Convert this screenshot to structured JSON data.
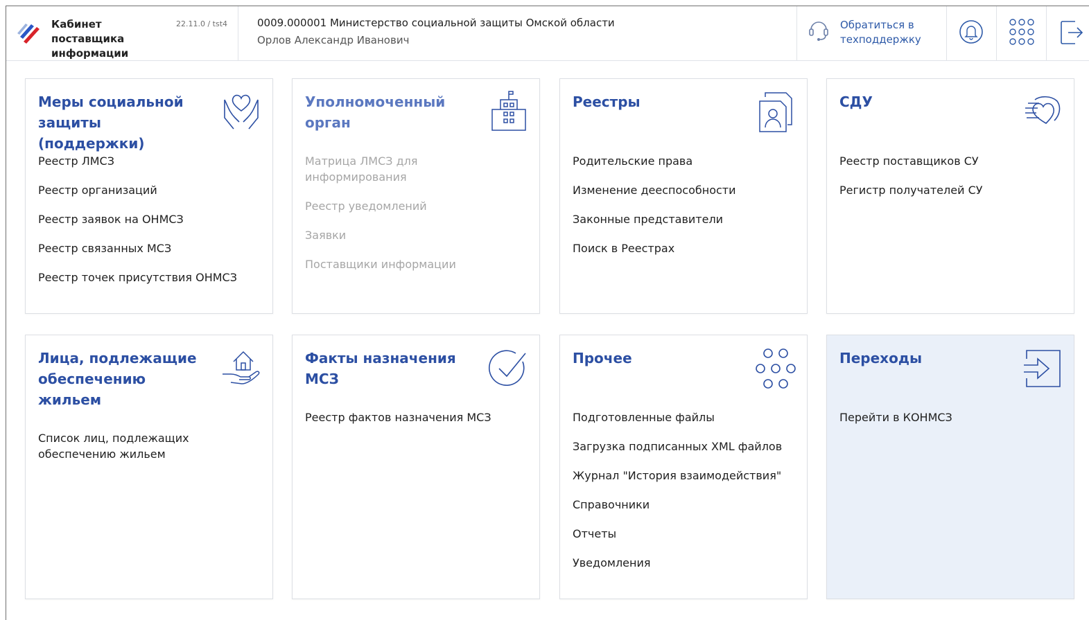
{
  "header": {
    "brand_title": "Кабинет поставщика информации",
    "version": "22.11.0 / tst4",
    "org_name": "0009.000001 Министерство социальной защиты Омской области",
    "user_name": "Орлов Александр Иванович",
    "support_label": "Обратиться в техподдержку",
    "colors": {
      "accent": "#2c4fa3",
      "brand_red": "#d8232a",
      "brand_blue": "#2a56c6"
    }
  },
  "cards": [
    {
      "title": "Меры социальной защиты (поддержки)",
      "icon": "hands-heart-icon",
      "items": [
        "Реестр ЛМСЗ",
        "Реестр организаций",
        "Реестр заявок на ОНМСЗ",
        "Реестр связанных МСЗ",
        "Реестр точек присутствия ОНМСЗ"
      ]
    },
    {
      "title": "Уполномоченный орган",
      "icon": "building-icon",
      "items": [
        "Матрица ЛМСЗ для информирования",
        "Реестр уведомлений",
        "Заявки",
        "Поставщики информации"
      ]
    },
    {
      "title": "Реестры",
      "icon": "documents-person-icon",
      "items": [
        "Родительские права",
        "Изменение дееспособности",
        "Законные представители",
        "Поиск в Реестрах"
      ]
    },
    {
      "title": "СДУ",
      "icon": "heart-speed-icon",
      "items": [
        "Реестр поставщиков СУ",
        "Регистр получателей СУ"
      ]
    },
    {
      "title": "Лица, подлежащие обеспечению жильем",
      "icon": "house-hand-icon",
      "items": [
        "Список лиц, подлежащих обеспечению жильем"
      ]
    },
    {
      "title": "Факты назначения МСЗ",
      "icon": "check-circle-icon",
      "items": [
        "Реестр фактов назначения МСЗ"
      ]
    },
    {
      "title": "Прочее",
      "icon": "dots-grid-icon",
      "items": [
        "Подготовленные файлы",
        "Загрузка подписанных XML файлов",
        "Журнал \"История взаимодействия\"",
        "Справочники",
        "Отчеты",
        "Уведомления"
      ]
    },
    {
      "title": "Переходы",
      "icon": "arrow-right-box-icon",
      "items": [
        "Перейти в КОНМСЗ"
      ]
    }
  ]
}
